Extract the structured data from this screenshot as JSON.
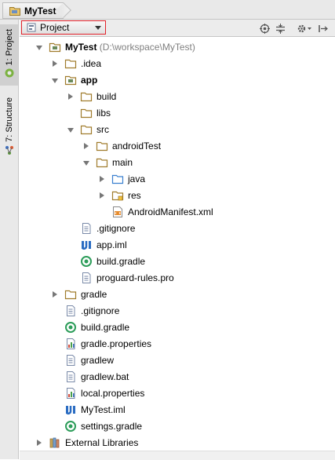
{
  "breadcrumb": {
    "label": "MyTest"
  },
  "sidebar": {
    "tabs": [
      {
        "label": "1: Project"
      },
      {
        "label": "7: Structure"
      }
    ]
  },
  "toolbar": {
    "view_selector": "Project",
    "buttons": [
      "scroll-to-source-icon",
      "collapse-all-icon",
      "settings-icon",
      "hide-panel-icon"
    ]
  },
  "tree": [
    {
      "label": "MyTest",
      "extra": "(D:\\workspace\\MyTest)",
      "bold": true,
      "icon": "module-folder",
      "depth": 0,
      "state": "open"
    },
    {
      "label": ".idea",
      "icon": "folder",
      "depth": 1,
      "state": "closed"
    },
    {
      "label": "app",
      "bold": true,
      "icon": "module-folder",
      "depth": 1,
      "state": "open"
    },
    {
      "label": "build",
      "icon": "folder",
      "depth": 2,
      "state": "closed"
    },
    {
      "label": "libs",
      "icon": "folder",
      "depth": 2,
      "state": "none"
    },
    {
      "label": "src",
      "icon": "folder",
      "depth": 2,
      "state": "open"
    },
    {
      "label": "androidTest",
      "icon": "folder",
      "depth": 3,
      "state": "closed"
    },
    {
      "label": "main",
      "icon": "folder",
      "depth": 3,
      "state": "open"
    },
    {
      "label": "java",
      "icon": "source-folder",
      "depth": 4,
      "state": "closed"
    },
    {
      "label": "res",
      "icon": "resource-folder",
      "depth": 4,
      "state": "closed"
    },
    {
      "label": "AndroidManifest.xml",
      "icon": "xml-file",
      "depth": 4,
      "state": "none"
    },
    {
      "label": ".gitignore",
      "icon": "text-file",
      "depth": 2,
      "state": "none"
    },
    {
      "label": "app.iml",
      "icon": "iml-file",
      "depth": 2,
      "state": "none"
    },
    {
      "label": "build.gradle",
      "icon": "gradle-file",
      "depth": 2,
      "state": "none"
    },
    {
      "label": "proguard-rules.pro",
      "icon": "text-file",
      "depth": 2,
      "state": "none"
    },
    {
      "label": "gradle",
      "icon": "folder",
      "depth": 1,
      "state": "closed"
    },
    {
      "label": ".gitignore",
      "icon": "text-file",
      "depth": 1,
      "state": "none"
    },
    {
      "label": "build.gradle",
      "icon": "gradle-file",
      "depth": 1,
      "state": "none"
    },
    {
      "label": "gradle.properties",
      "icon": "properties-file",
      "depth": 1,
      "state": "none"
    },
    {
      "label": "gradlew",
      "icon": "text-file",
      "depth": 1,
      "state": "none"
    },
    {
      "label": "gradlew.bat",
      "icon": "text-file",
      "depth": 1,
      "state": "none"
    },
    {
      "label": "local.properties",
      "icon": "properties-file",
      "depth": 1,
      "state": "none"
    },
    {
      "label": "MyTest.iml",
      "icon": "iml-file",
      "depth": 1,
      "state": "none"
    },
    {
      "label": "settings.gradle",
      "icon": "gradle-file",
      "depth": 1,
      "state": "none"
    },
    {
      "label": "External Libraries",
      "icon": "libraries",
      "depth": 0,
      "state": "closed"
    }
  ],
  "colors": {
    "dropdown_border": "#e2222a",
    "folder": "#c69c3c",
    "source_folder": "#4a90d9"
  }
}
